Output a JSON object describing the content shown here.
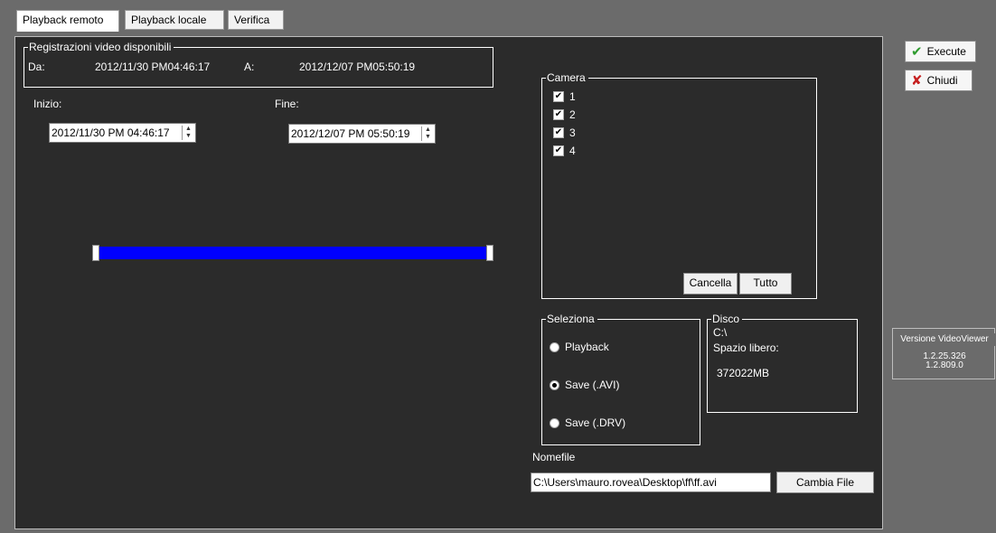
{
  "tabs": [
    {
      "label": "Playback remoto",
      "active": true
    },
    {
      "label": "Playback locale",
      "active": false
    },
    {
      "label": "Verifica",
      "active": false
    }
  ],
  "recordings": {
    "title": "Registrazioni video disponibili",
    "from_label": "Da:",
    "from_value": "2012/11/30 PM04:46:17",
    "to_label": "A:",
    "to_value": "2012/12/07 PM05:50:19"
  },
  "range": {
    "start_label": "Inizio:",
    "start_value": "2012/11/30 PM 04:46:17",
    "end_label": "Fine:",
    "end_value": "2012/12/07 PM 05:50:19"
  },
  "timeline": {
    "selection_start_fraction": 0.0,
    "selection_end_fraction": 1.0,
    "color": "#0000ff"
  },
  "camera": {
    "title": "Camera",
    "items": [
      {
        "label": "1",
        "checked": true
      },
      {
        "label": "2",
        "checked": true
      },
      {
        "label": "3",
        "checked": true
      },
      {
        "label": "4",
        "checked": true
      }
    ],
    "cancel_label": "Cancella",
    "all_label": "Tutto"
  },
  "select": {
    "title": "Seleziona",
    "options": [
      {
        "label": "Playback",
        "selected": false
      },
      {
        "label": "Save (.AVI)",
        "selected": true
      },
      {
        "label": "Save (.DRV)",
        "selected": false
      }
    ]
  },
  "disk": {
    "title": "Disco",
    "drive": "C:\\",
    "free_label": "Spazio libero:",
    "free_value": "372022MB"
  },
  "file": {
    "label": "Nomefile",
    "value": "C:\\Users\\mauro.rovea\\Desktop\\ff\\ff.avi",
    "change_label": "Cambia File"
  },
  "actions": {
    "execute_label": "Execute",
    "execute_icon": "check-icon",
    "close_label": "Chiudi",
    "close_icon": "x-icon"
  },
  "version": {
    "title": "Versione VideoViewer",
    "v1": "1.2.25.326",
    "v2": "1.2.809.0"
  },
  "colors": {
    "background": "#6b6b6b",
    "panel": "#2b2b2b",
    "timeline_bar": "#0000ff",
    "execute_icon": "#2e9b2e",
    "close_icon": "#c62020"
  }
}
